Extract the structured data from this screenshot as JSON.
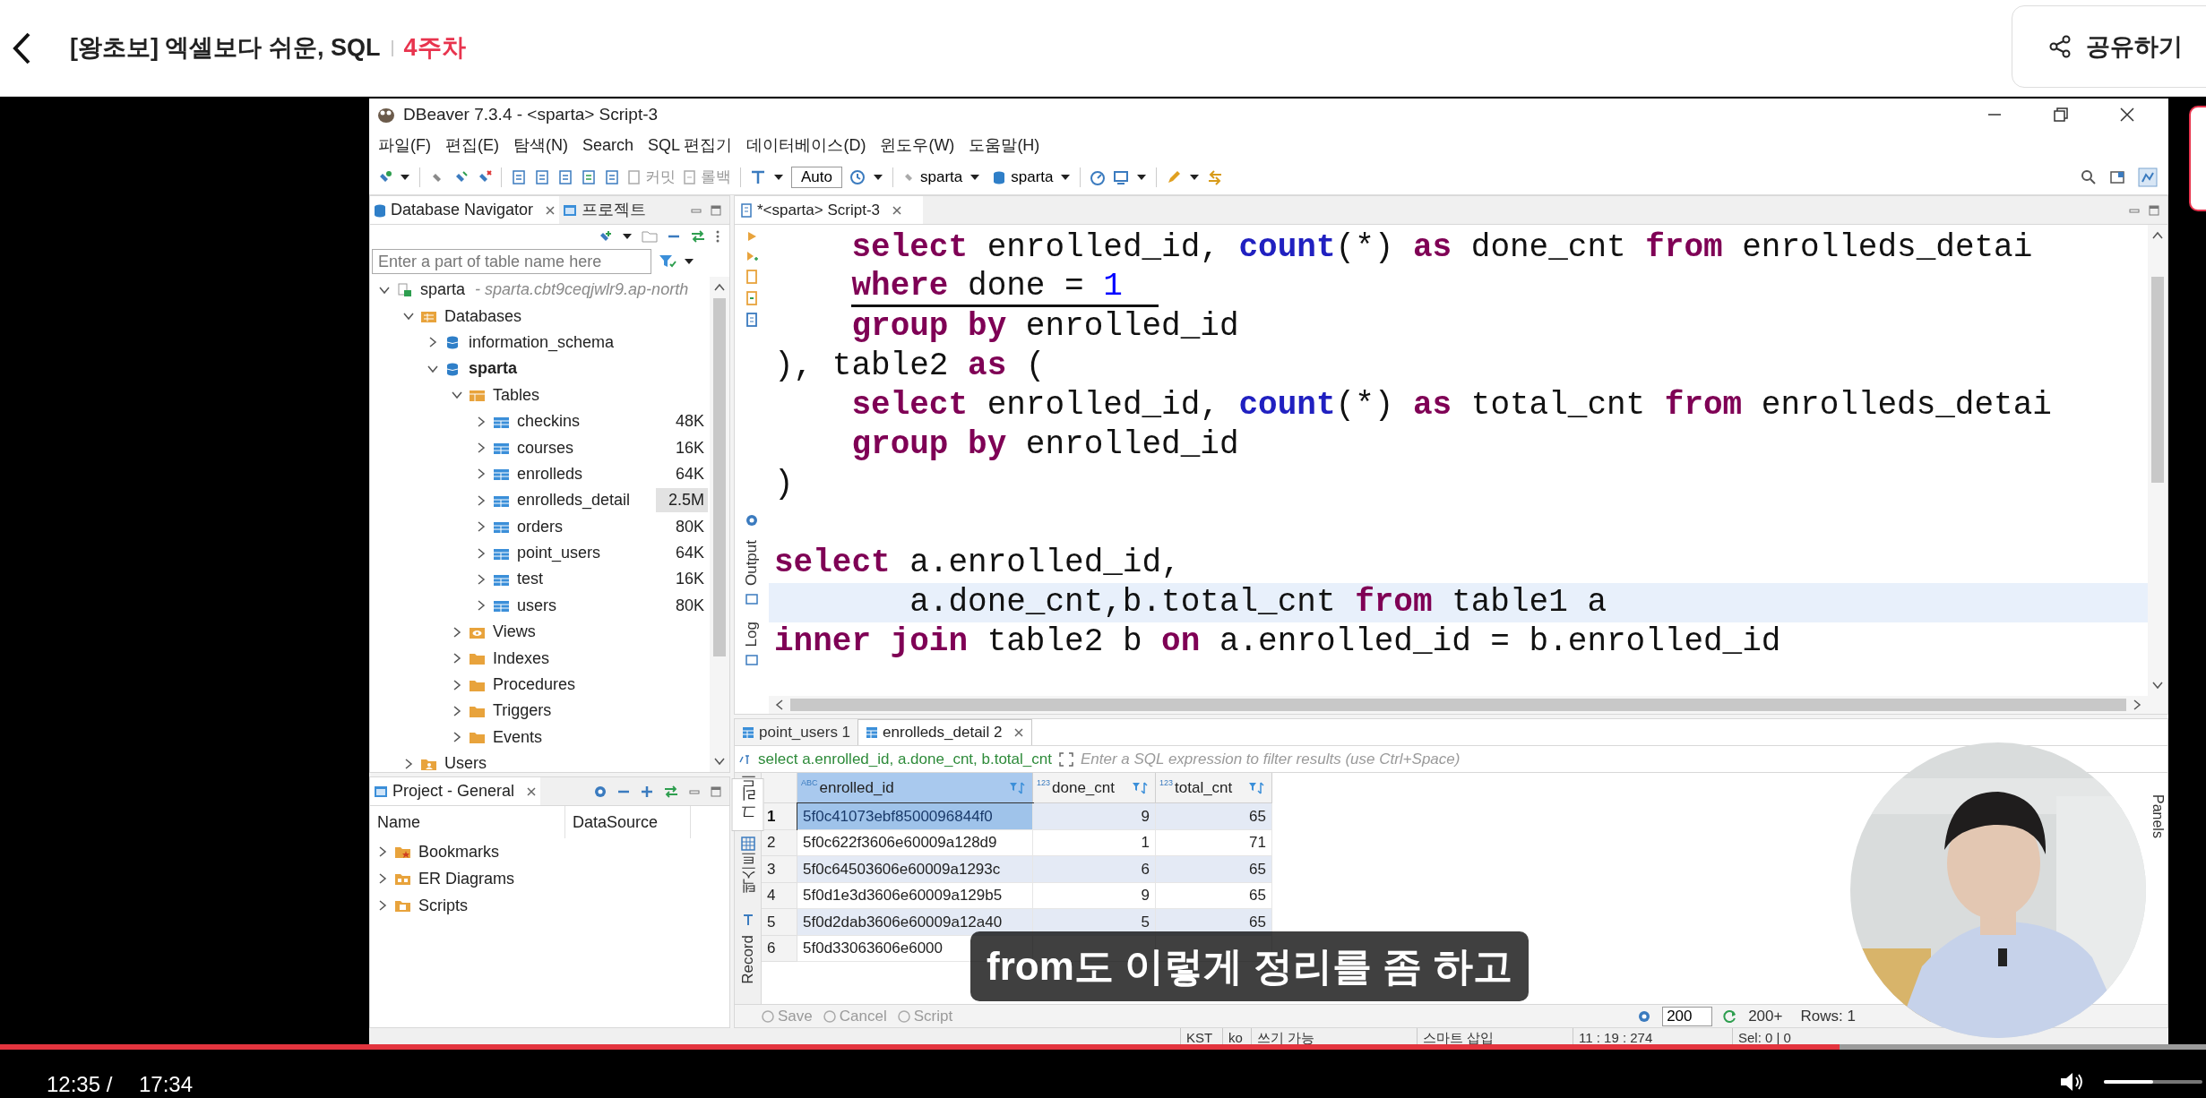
{
  "header": {
    "title": "[왕초보] 엑셀보다 쉬운, SQL",
    "week": "4주차",
    "share": "공유하기"
  },
  "app": {
    "title": "DBeaver 7.3.4 - <sparta> Script-3",
    "menu": [
      "파일(F)",
      "편집(E)",
      "탐색(N)",
      "Search",
      "SQL 편집기",
      "데이터베이스(D)",
      "윈도우(W)",
      "도움말(H)"
    ],
    "toolbar": {
      "commit": {
        "label": "커밋",
        "disabled": true
      },
      "rollback": {
        "label": "롤백",
        "disabled": true
      },
      "mode": "Auto",
      "datasource": "sparta",
      "schema": "sparta"
    },
    "navigator": {
      "tabs": [
        {
          "label": "Database Navigator",
          "selected": true
        },
        {
          "label": "프로젝트",
          "selected": false
        }
      ],
      "filter_placeholder": "Enter a part of table name here",
      "tree": [
        {
          "label": "sparta",
          "detail": "- sparta.cbt9ceqjwlr9.ap-north",
          "kind": "connection",
          "expanded": true,
          "children": [
            {
              "label": "Databases",
              "kind": "databases",
              "expanded": true,
              "children": [
                {
                  "label": "information_schema",
                  "kind": "schema",
                  "expanded": false,
                  "bold": false
                },
                {
                  "label": "sparta",
                  "kind": "schema",
                  "expanded": true,
                  "bold": true,
                  "children": [
                    {
                      "label": "Tables",
                      "kind": "tables",
                      "expanded": true,
                      "children": [
                        {
                          "label": "checkins",
                          "kind": "table",
                          "size": "48K",
                          "expanded": false,
                          "highlighted": false
                        },
                        {
                          "label": "courses",
                          "kind": "table",
                          "size": "16K",
                          "expanded": false,
                          "highlighted": false
                        },
                        {
                          "label": "enrolleds",
                          "kind": "table",
                          "size": "64K",
                          "expanded": false,
                          "highlighted": false
                        },
                        {
                          "label": "enrolleds_detail",
                          "kind": "table",
                          "size": "2.5M",
                          "expanded": false,
                          "highlighted": true
                        },
                        {
                          "label": "orders",
                          "kind": "table",
                          "size": "80K",
                          "expanded": false,
                          "highlighted": false
                        },
                        {
                          "label": "point_users",
                          "kind": "table",
                          "size": "64K",
                          "expanded": false,
                          "highlighted": false
                        },
                        {
                          "label": "test",
                          "kind": "table",
                          "size": "16K",
                          "expanded": false,
                          "highlighted": false
                        },
                        {
                          "label": "users",
                          "kind": "table",
                          "size": "80K",
                          "expanded": false,
                          "highlighted": false
                        }
                      ]
                    },
                    {
                      "label": "Views",
                      "kind": "views",
                      "expanded": false
                    },
                    {
                      "label": "Indexes",
                      "kind": "folder",
                      "expanded": false
                    },
                    {
                      "label": "Procedures",
                      "kind": "folder",
                      "expanded": false
                    },
                    {
                      "label": "Triggers",
                      "kind": "folder",
                      "expanded": false
                    },
                    {
                      "label": "Events",
                      "kind": "folder",
                      "expanded": false
                    }
                  ]
                }
              ]
            },
            {
              "label": "Users",
              "kind": "users",
              "expanded": false
            }
          ]
        }
      ]
    },
    "project": {
      "title": "Project - General",
      "columns": [
        "Name",
        "DataSource"
      ],
      "items": [
        {
          "label": "Bookmarks",
          "kind": "bookmarks",
          "expanded": false
        },
        {
          "label": "ER Diagrams",
          "kind": "diagrams",
          "expanded": false
        },
        {
          "label": "Scripts",
          "kind": "scripts",
          "expanded": false
        }
      ]
    },
    "editor": {
      "tab": "*<sparta> Script-3",
      "side_labels": [
        "Output",
        "Log"
      ],
      "lines": [
        {
          "kind": "code",
          "current": false,
          "underlined": false,
          "tokens": [
            {
              "kind": "kw",
              "text": "    select"
            },
            {
              "kind": "plain",
              "text": " enrolled_id, "
            },
            {
              "kind": "fn",
              "text": "count"
            },
            {
              "kind": "plain",
              "text": "(*) "
            },
            {
              "kind": "kw",
              "text": "as"
            },
            {
              "kind": "plain",
              "text": " done_cnt "
            },
            {
              "kind": "kw",
              "text": "from"
            },
            {
              "kind": "plain",
              "text": " enrolleds_detai"
            }
          ]
        },
        {
          "kind": "code",
          "current": false,
          "underlined": true,
          "tokens": [
            {
              "kind": "kw",
              "text": "    where"
            },
            {
              "kind": "plain",
              "text": " done = "
            },
            {
              "kind": "num",
              "text": "1"
            }
          ]
        },
        {
          "kind": "code",
          "current": false,
          "underlined": false,
          "tokens": [
            {
              "kind": "kw",
              "text": "    group by"
            },
            {
              "kind": "plain",
              "text": " enrolled_id"
            }
          ]
        },
        {
          "kind": "code",
          "current": false,
          "underlined": false,
          "tokens": [
            {
              "kind": "plain",
              "text": "), table2 "
            },
            {
              "kind": "kw",
              "text": "as"
            },
            {
              "kind": "plain",
              "text": " ("
            }
          ]
        },
        {
          "kind": "code",
          "current": false,
          "underlined": false,
          "tokens": [
            {
              "kind": "kw",
              "text": "    select"
            },
            {
              "kind": "plain",
              "text": " enrolled_id, "
            },
            {
              "kind": "fn",
              "text": "count"
            },
            {
              "kind": "plain",
              "text": "(*) "
            },
            {
              "kind": "kw",
              "text": "as"
            },
            {
              "kind": "plain",
              "text": " total_cnt "
            },
            {
              "kind": "kw",
              "text": "from"
            },
            {
              "kind": "plain",
              "text": " enrolleds_detai"
            }
          ]
        },
        {
          "kind": "code",
          "current": false,
          "underlined": false,
          "tokens": [
            {
              "kind": "kw",
              "text": "    group by"
            },
            {
              "kind": "plain",
              "text": " enrolled_id"
            }
          ]
        },
        {
          "kind": "code",
          "current": false,
          "underlined": false,
          "tokens": [
            {
              "kind": "plain",
              "text": ")"
            }
          ]
        },
        {
          "kind": "blank"
        },
        {
          "kind": "code",
          "current": false,
          "underlined": false,
          "tokens": [
            {
              "kind": "kw",
              "text": "select"
            },
            {
              "kind": "plain",
              "text": " a.enrolled_id,"
            }
          ]
        },
        {
          "kind": "code",
          "current": true,
          "underlined": false,
          "tokens": [
            {
              "kind": "plain",
              "text": "       a.done_cnt,b.total_cnt "
            },
            {
              "kind": "kw",
              "text": "from"
            },
            {
              "kind": "plain",
              "text": " table1 a"
            }
          ]
        },
        {
          "kind": "code",
          "current": false,
          "underlined": false,
          "tokens": [
            {
              "kind": "kw",
              "text": "inner join"
            },
            {
              "kind": "plain",
              "text": " table2 b "
            },
            {
              "kind": "kw",
              "text": "on"
            },
            {
              "kind": "plain",
              "text": " a.enrolled_id = b.enrolled_id"
            }
          ]
        }
      ]
    },
    "results": {
      "tabs": [
        {
          "label": "point_users 1",
          "selected": false
        },
        {
          "label": "enrolleds_detail 2",
          "selected": true
        }
      ],
      "query": "select a.enrolled_id, a.done_cnt, b.total_cnt",
      "filter_placeholder": "Enter a SQL expression to filter results (use Ctrl+Space)",
      "views": [
        {
          "label": "그리드",
          "selected": true
        },
        {
          "label": "텍스트",
          "selected": false
        },
        {
          "label": "Record",
          "selected": false
        }
      ],
      "columns": [
        {
          "name": "enrolled_id",
          "type": "ABC",
          "selected": true
        },
        {
          "name": "done_cnt",
          "type": "123",
          "selected": false
        },
        {
          "name": "total_cnt",
          "type": "123",
          "selected": false
        }
      ],
      "rows": [
        {
          "number": "1",
          "selected": true,
          "cells": [
            "5f0c41073ebf8500096844f0",
            "9",
            "65"
          ]
        },
        {
          "number": "2",
          "selected": false,
          "cells": [
            "5f0c622f3606e60009a128d9",
            "1",
            "71"
          ]
        },
        {
          "number": "3",
          "selected": false,
          "cells": [
            "5f0c64503606e60009a1293c",
            "6",
            "65"
          ]
        },
        {
          "number": "4",
          "selected": false,
          "cells": [
            "5f0d1e3d3606e60009a129b5",
            "9",
            "65"
          ]
        },
        {
          "number": "5",
          "selected": false,
          "cells": [
            "5f0d2dab3606e60009a12a40",
            "5",
            "65"
          ]
        },
        {
          "number": "6",
          "selected": false,
          "cells": [
            "5f0d33063606e6000"
          ]
        }
      ],
      "actions": [
        {
          "label": "Save",
          "disabled": true
        },
        {
          "label": "Cancel",
          "disabled": true
        },
        {
          "label": "Script",
          "disabled": true
        }
      ],
      "fetch_size": "200",
      "fetch_more": "200+",
      "row_count": "Rows: 1",
      "panels": "Panels"
    },
    "status_bar": [
      "KST",
      "ko",
      "쓰기 가능",
      "스마트 삽입",
      "11 : 19 : 274",
      "Sel: 0 | 0"
    ]
  },
  "subtitle": "from도 이렇게 정리를 좀 하고",
  "player": {
    "current": "12:35 /",
    "duration": "17:34",
    "progress": {
      "level": 0.834
    },
    "volume": {
      "level": 0.5
    }
  }
}
